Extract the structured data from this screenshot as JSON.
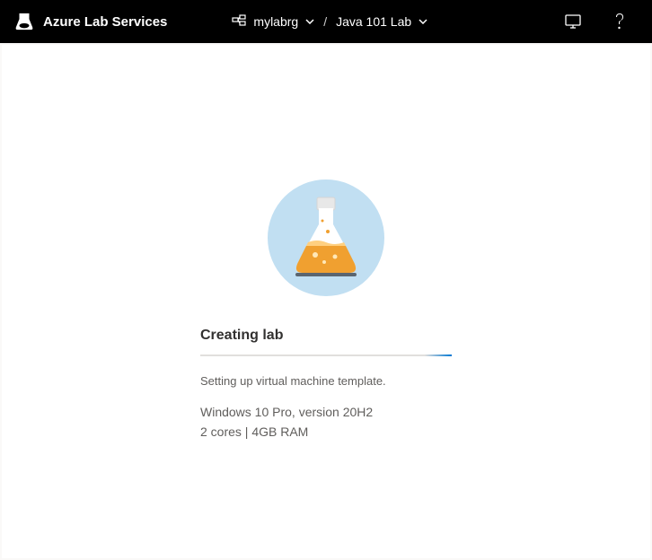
{
  "header": {
    "product_name": "Azure Lab Services",
    "breadcrumb": {
      "resource_group": "mylabrg",
      "lab_name": "Java 101 Lab"
    }
  },
  "main": {
    "title": "Creating lab",
    "status": "Setting up virtual machine template.",
    "os_line": "Windows 10 Pro, version 20H2",
    "spec_line": "2 cores | 4GB RAM"
  }
}
